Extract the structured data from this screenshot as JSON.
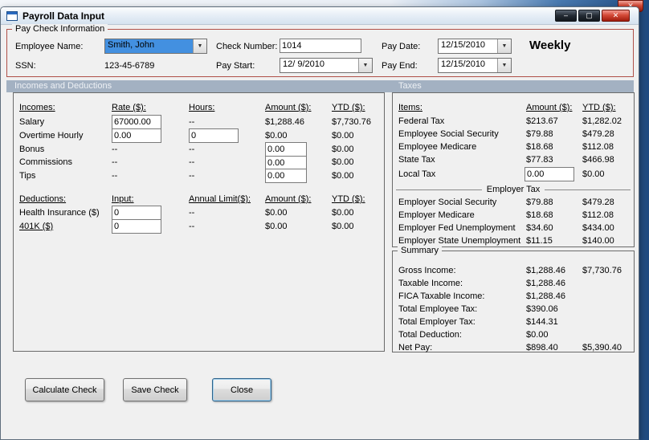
{
  "window": {
    "title": "Payroll Data Input"
  },
  "icons": {
    "dropdown": "▼",
    "minimize": "–",
    "maximize": "▢",
    "close": "✕",
    "parent_close": "✕"
  },
  "paycheck": {
    "legend": "Pay Check Information",
    "employee_label": "Employee Name:",
    "employee_value": "Smith, John",
    "ssn_label": "SSN:",
    "ssn_value": "123-45-6789",
    "check_label": "Check Number:",
    "check_value": "1014",
    "paystart_label": "Pay Start:",
    "paystart_value": "12/ 9/2010",
    "paydate_label": "Pay Date:",
    "paydate_value": "12/15/2010",
    "payend_label": "Pay End:",
    "payend_value": "12/15/2010",
    "frequency": "Weekly"
  },
  "bands": {
    "left": "Incomes and Deductions",
    "right": "Taxes"
  },
  "incomes": {
    "headers": {
      "c1": "Incomes:",
      "c2": "Rate ($):",
      "c3": "Hours:",
      "c4": "Amount ($):",
      "c5": "YTD ($):"
    },
    "salary": {
      "label": "Salary",
      "rate": "67000.00",
      "hours": "--",
      "amount": "$1,288.46",
      "ytd": "$7,730.76"
    },
    "overtime": {
      "label": "Overtime Hourly",
      "rate": "0.00",
      "hours": "0",
      "amount": "$0.00",
      "ytd": "$0.00"
    },
    "bonus": {
      "label": "Bonus",
      "rate": "--",
      "hours": "--",
      "amount": "0.00",
      "ytd": "$0.00"
    },
    "commissions": {
      "label": "Commissions",
      "rate": "--",
      "hours": "--",
      "amount": "0.00",
      "ytd": "$0.00"
    },
    "tips": {
      "label": "Tips",
      "rate": "--",
      "hours": "--",
      "amount": "0.00",
      "ytd": "$0.00"
    }
  },
  "deductions": {
    "headers": {
      "c1": "Deductions:",
      "c2": "Input:",
      "c3": "Annual Limit($):",
      "c4": "Amount ($):",
      "c5": "YTD ($):"
    },
    "health": {
      "label": "Health Insurance  ($)",
      "input": "0",
      "limit": "--",
      "amount": "$0.00",
      "ytd": "$0.00"
    },
    "k401": {
      "label": "401K  ($)",
      "input": "0",
      "limit": "--",
      "amount": "$0.00",
      "ytd": "$0.00"
    }
  },
  "taxes": {
    "headers": {
      "c1": "Items:",
      "c2": "Amount ($):",
      "c3": "YTD ($):"
    },
    "rows": [
      {
        "label": "Federal Tax",
        "amount": "$213.67",
        "ytd": "$1,282.02"
      },
      {
        "label": "Employee Social Security",
        "amount": "$79.88",
        "ytd": "$479.28"
      },
      {
        "label": "Employee Medicare",
        "amount": "$18.68",
        "ytd": "$112.08"
      },
      {
        "label": "State Tax",
        "amount": "$77.83",
        "ytd": "$466.98"
      }
    ],
    "local": {
      "label": "Local Tax",
      "amount": "0.00",
      "ytd": "$0.00"
    },
    "employer_header": "Employer Tax",
    "employer_rows": [
      {
        "label": "Employer Social Security",
        "amount": "$79.88",
        "ytd": "$479.28"
      },
      {
        "label": "Employer Medicare",
        "amount": "$18.68",
        "ytd": "$112.08"
      },
      {
        "label": "Employer Fed Unemployment",
        "amount": "$34.60",
        "ytd": "$434.00"
      },
      {
        "label": "Employer State Unemployment",
        "amount": "$11.15",
        "ytd": "$140.00"
      }
    ]
  },
  "summary": {
    "legend": "Summary",
    "rows": [
      {
        "label": "Gross Income:",
        "v1": "$1,288.46",
        "v2": "$7,730.76"
      },
      {
        "label": "Taxable Income:",
        "v1": "$1,288.46",
        "v2": ""
      },
      {
        "label": "FICA Taxable Income:",
        "v1": "$1,288.46",
        "v2": ""
      },
      {
        "label": "Total Employee Tax:",
        "v1": "$390.06",
        "v2": ""
      },
      {
        "label": "Total Employer Tax:",
        "v1": "$144.31",
        "v2": ""
      },
      {
        "label": "Total Deduction:",
        "v1": "$0.00",
        "v2": ""
      },
      {
        "label": "Net Pay:",
        "v1": "$898.40",
        "v2": "$5,390.40"
      }
    ]
  },
  "buttons": {
    "calculate": "Calculate Check",
    "save": "Save Check",
    "close": "Close"
  }
}
